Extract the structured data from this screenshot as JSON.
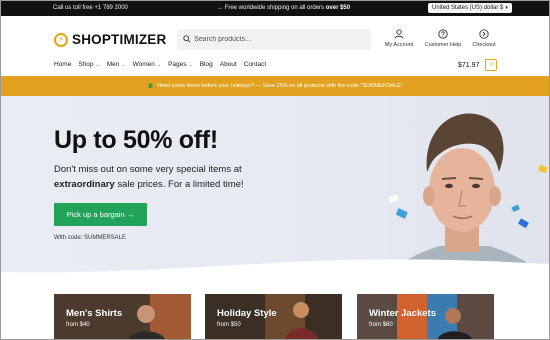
{
  "topbar": {
    "call": "Call us toll free +1 789 2000",
    "shipping_prefix": "→ Free worldwide shipping on all orders",
    "shipping_amount": "over $50",
    "currency": "United States (US) dollar $"
  },
  "header": {
    "brand": "SHOPTIMIZER",
    "search_placeholder": "Search products...",
    "account_label": "My Account",
    "help_label": "Customer Help",
    "checkout_label": "Checkout"
  },
  "nav": {
    "items": [
      {
        "label": "Home",
        "dropdown": false
      },
      {
        "label": "Shop",
        "dropdown": true
      },
      {
        "label": "Men",
        "dropdown": true
      },
      {
        "label": "Women",
        "dropdown": true
      },
      {
        "label": "Pages",
        "dropdown": true
      },
      {
        "label": "Blog",
        "dropdown": false
      },
      {
        "label": "About",
        "dropdown": false
      },
      {
        "label": "Contact",
        "dropdown": false
      }
    ],
    "cart_total": "$71.97",
    "cart_count": "0"
  },
  "promo": {
    "emoji": "🎄",
    "text": "Need some items before your holidays? — Save 25% on all products with the code \"SUMMERSALE\""
  },
  "hero": {
    "headline": "Up to 50% off!",
    "sub_part1": "Don't miss out on some very special items at",
    "sub_bold": "extraordinary",
    "sub_part2": "sale prices. For a limited time!",
    "cta": "Pick up a bargain →",
    "code": "With code: SUMMERSALE"
  },
  "categories": [
    {
      "title": "Men's Shirts",
      "from": "from $40"
    },
    {
      "title": "Holiday Style",
      "from": "from $50"
    },
    {
      "title": "Winter Jackets",
      "from": "from $60"
    }
  ],
  "colors": {
    "accent": "#e2a11e",
    "cta_green": "#21a35a",
    "topbar_bg": "#111111",
    "hero_bg": "#e9ecf3"
  }
}
